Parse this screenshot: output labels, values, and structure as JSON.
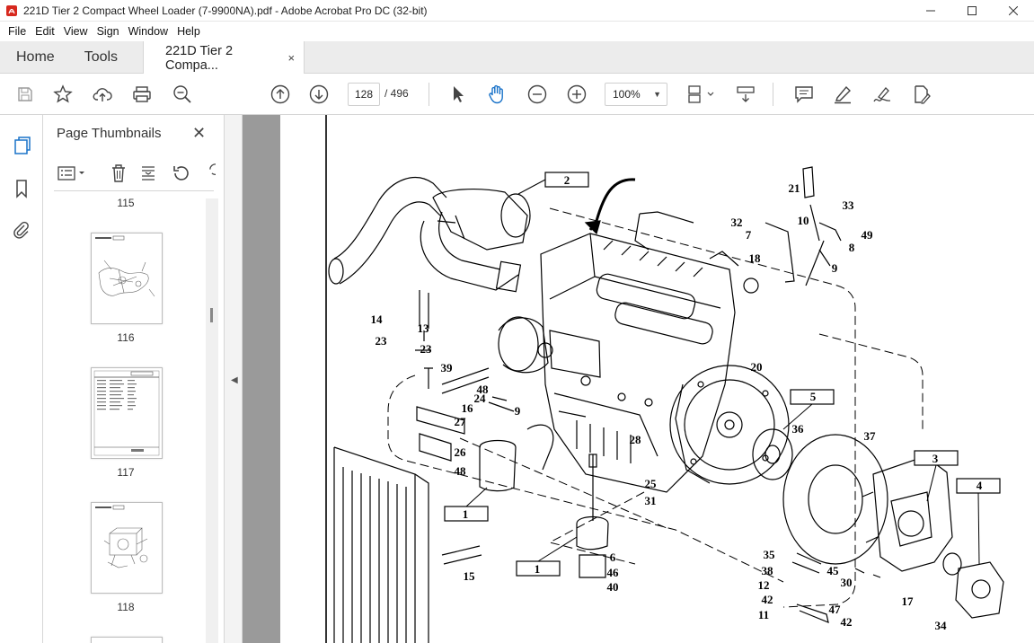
{
  "window": {
    "title": "221D Tier 2 Compact Wheel Loader (7-9900NA).pdf - Adobe Acrobat Pro DC (32-bit)"
  },
  "menu": [
    "File",
    "Edit",
    "View",
    "Sign",
    "Window",
    "Help"
  ],
  "tabs": {
    "home": "Home",
    "tools": "Tools",
    "document": "221D Tier 2 Compa...",
    "close": "×"
  },
  "toolbar": {
    "current_page": "128",
    "page_total": "/ 496",
    "zoom": "100%"
  },
  "panel": {
    "title": "Page Thumbnails",
    "close": "✕",
    "thumbnails": [
      {
        "label": "115"
      },
      {
        "label": "116"
      },
      {
        "label": "117"
      },
      {
        "label": "118"
      }
    ]
  },
  "diagram": {
    "callouts": [
      "2",
      "32",
      "21",
      "33",
      "10",
      "7",
      "49",
      "8",
      "18",
      "9",
      "14",
      "13",
      "23",
      "23",
      "39",
      "48",
      "24",
      "16",
      "9",
      "27",
      "26",
      "48",
      "20",
      "5",
      "36",
      "37",
      "28",
      "3",
      "4",
      "25",
      "31",
      "1",
      "1",
      "6",
      "46",
      "40",
      "15",
      "35",
      "38",
      "45",
      "12",
      "30",
      "42",
      "17",
      "47",
      "11",
      "42",
      "34"
    ]
  },
  "colors": {
    "acrobat_red": "#d7281e",
    "accent_blue": "#1a73c9",
    "doc_bg": "#9a9a9a"
  }
}
